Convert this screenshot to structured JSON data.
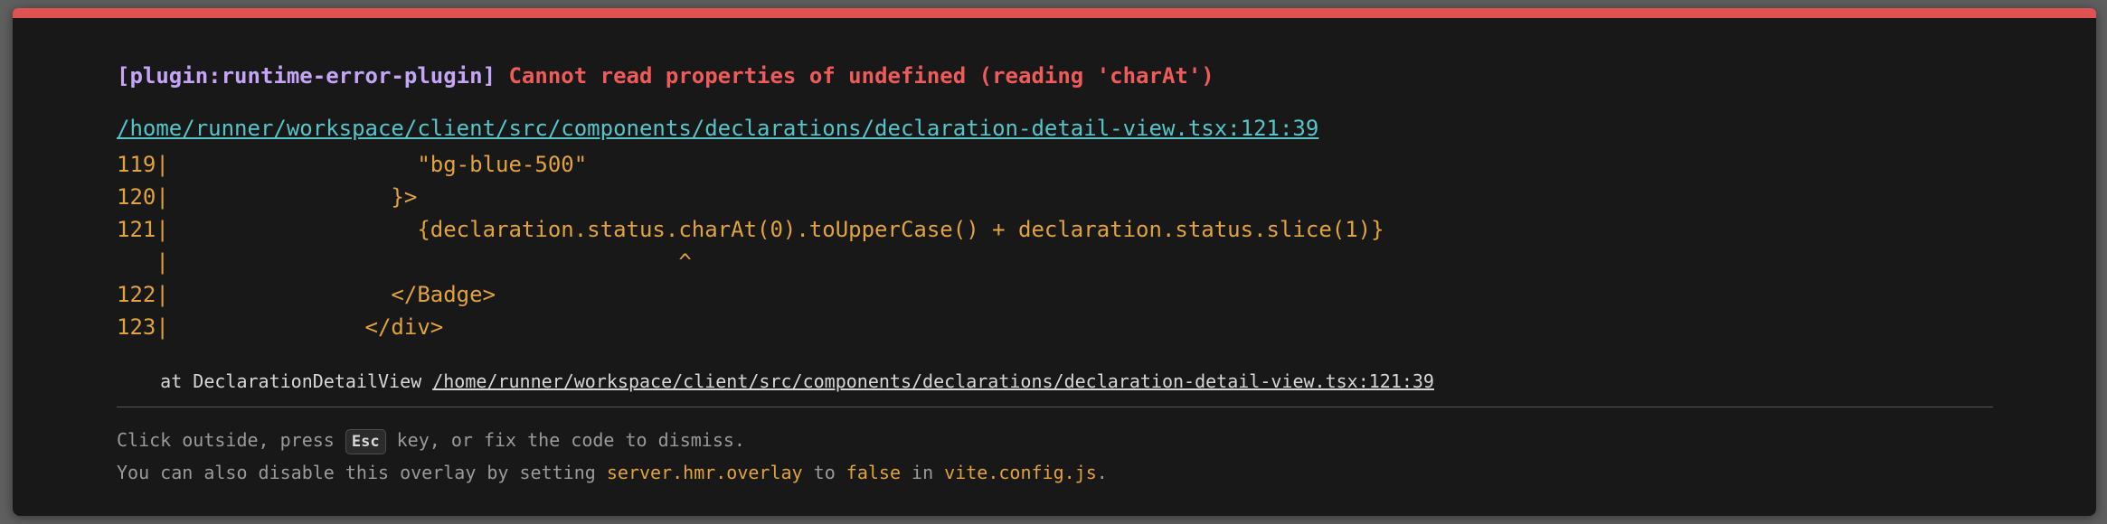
{
  "overlay": {
    "plugin": "[plugin:runtime-error-plugin]",
    "message": "Cannot read properties of undefined (reading 'charAt')",
    "file_link": "/home/runner/workspace/client/src/components/declarations/declaration-detail-view.tsx:121:39",
    "frame": [
      "119|                   \"bg-blue-500\"",
      "120|                 }>",
      "121|                   {declaration.status.charAt(0).toUpperCase() + declaration.status.slice(1)}",
      "   |                                       ^",
      "122|                 </Badge>",
      "123|               </div>"
    ],
    "stack_prefix": "    at DeclarationDetailView ",
    "stack_link": "/home/runner/workspace/client/src/components/declarations/declaration-detail-view.tsx:121:39",
    "tip1_before": "Click outside, press ",
    "tip1_key": "Esc",
    "tip1_after": " key, or fix the code to dismiss.",
    "tip2_before": "You can also disable this overlay by setting ",
    "tip2_code1": "server.hmr.overlay",
    "tip2_mid1": " to ",
    "tip2_code2": "false",
    "tip2_mid2": " in ",
    "tip2_code3": "vite.config.js",
    "tip2_end": "."
  },
  "colors": {
    "accent_bar": "#e05252",
    "plugin": "#c5a5f5",
    "message": "#ef5b5b",
    "link": "#56c5c9",
    "code": "#e0a33e",
    "background": "#181818"
  }
}
